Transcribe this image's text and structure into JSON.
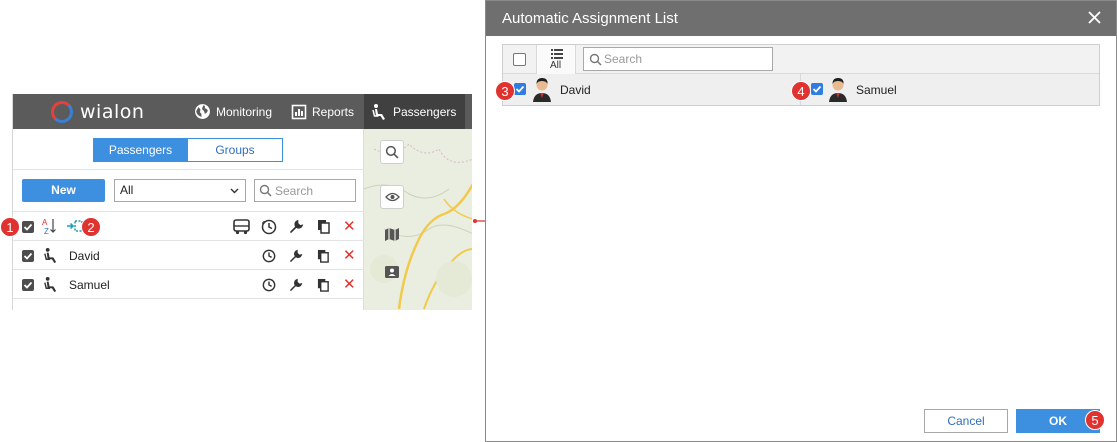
{
  "app": {
    "logo_text": "wialon",
    "nav": {
      "monitoring": "Monitoring",
      "reports": "Reports",
      "passengers": "Passengers"
    }
  },
  "panel": {
    "tabs": {
      "passengers": "Passengers",
      "groups": "Groups"
    },
    "new_button": "New",
    "filter_selected": "All",
    "search_placeholder": "Search",
    "sort_label": "A↓Z",
    "rows": [
      {
        "name": "David"
      },
      {
        "name": "Samuel"
      }
    ]
  },
  "dialog": {
    "title": "Automatic Assignment List",
    "all_label": "All",
    "search_placeholder": "Search",
    "items": [
      {
        "name": "David",
        "checked": true
      },
      {
        "name": "Samuel",
        "checked": true
      }
    ],
    "cancel_label": "Cancel",
    "ok_label": "OK"
  },
  "badges": [
    "1",
    "2",
    "3",
    "4",
    "5"
  ],
  "colors": {
    "accent": "#3d8fe0",
    "topbar": "#5b5b5b",
    "dialog_header": "#6f6f6f",
    "delete": "#e0322e",
    "badge": "#e0322e"
  },
  "icons": [
    "globe-icon",
    "reports-icon",
    "passenger-icon",
    "search-icon",
    "sort-az-icon",
    "assign-icon",
    "bus-icon",
    "history-icon",
    "wrench-icon",
    "copy-icon",
    "delete-icon",
    "eye-icon",
    "map-icon",
    "contact-card-icon",
    "close-icon",
    "list-icon",
    "user-avatar-icon",
    "arrow-right-icon"
  ]
}
